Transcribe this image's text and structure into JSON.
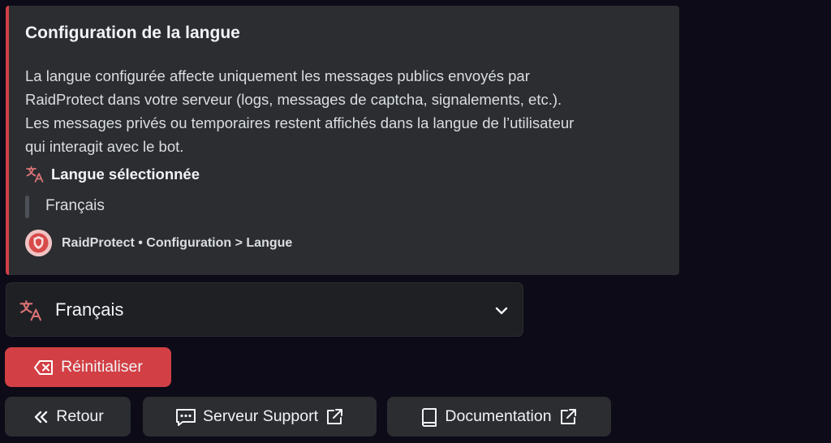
{
  "embed": {
    "accent_color": "#d23f44",
    "title": "Configuration de la langue",
    "description_lines": [
      "La langue configurée affecte uniquement les messages publics envoyés par",
      "RaidProtect dans votre serveur (logs, messages de captcha, signalements, etc.).",
      "Les messages privés ou temporaires restent affichés dans la langue de l’utilisateur",
      "qui interagit avec le bot."
    ],
    "field": {
      "icon": "translate-icon",
      "name": "Langue sélectionnée",
      "value": "Français"
    },
    "footer": {
      "icon": "raidprotect-avatar",
      "text": "RaidProtect • Configuration > Langue"
    }
  },
  "language_select": {
    "icon": "translate-icon",
    "selected": "Français",
    "chevron": "chevron-down-icon"
  },
  "buttons": {
    "reset": {
      "label": "Réinitialiser",
      "icon": "backspace-icon",
      "color": "#d23f44"
    },
    "back": {
      "label": "Retour",
      "icon": "double-chevron-left-icon"
    },
    "support": {
      "label": "Serveur Support",
      "icon": "message-icon",
      "external": "external-link-icon"
    },
    "docs": {
      "label": "Documentation",
      "icon": "book-icon",
      "external": "external-link-icon"
    }
  }
}
